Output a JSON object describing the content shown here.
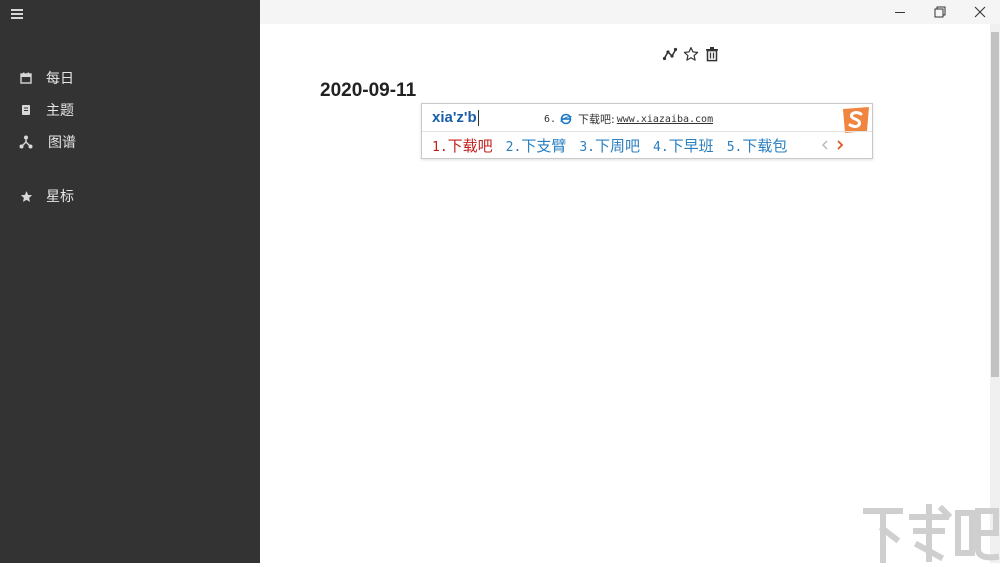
{
  "sidebar": {
    "items": [
      {
        "label": "每日",
        "icon": "calendar-icon"
      },
      {
        "label": "主题",
        "icon": "notebook-icon"
      },
      {
        "label": "图谱",
        "icon": "graph-icon"
      },
      {
        "label": "星标",
        "icon": "star-icon"
      }
    ]
  },
  "toolbar": {
    "icons": [
      "link-graph-icon",
      "star-outline-icon",
      "trash-icon"
    ]
  },
  "page": {
    "date": "2020-09-11"
  },
  "ime": {
    "input": "xia'z'b",
    "suggestion": {
      "number": "6.",
      "text": "下载吧:",
      "url": "www.xiazaiba.com"
    },
    "candidates": [
      {
        "num": "1.",
        "text": "下载吧",
        "selected": true
      },
      {
        "num": "2.",
        "text": "下支臂",
        "selected": false
      },
      {
        "num": "3.",
        "text": "下周吧",
        "selected": false
      },
      {
        "num": "4.",
        "text": "下早班",
        "selected": false
      },
      {
        "num": "5.",
        "text": "下载包",
        "selected": false
      }
    ]
  },
  "colors": {
    "sidebar_bg": "#333333",
    "ime_input": "#1a5ea8",
    "candidate": "#2a7fc0",
    "candidate_selected": "#c0201d",
    "ime_logo": "#f08540"
  }
}
